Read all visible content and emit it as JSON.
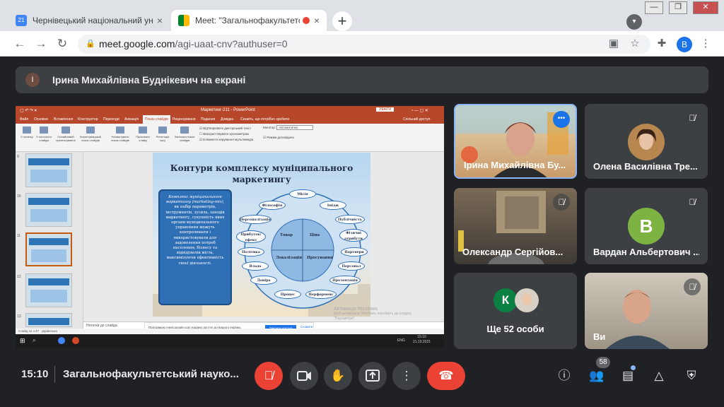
{
  "browser": {
    "tabs": [
      {
        "title": "Чернівецький національний уні",
        "icon": "calendar-21-icon",
        "close": "×"
      },
      {
        "title": "Meet: \"Загальнофакультетсь",
        "icon": "meet-icon",
        "close": "×"
      }
    ],
    "new_tab": "+",
    "url_host": "meet.google.com",
    "url_path": "/agi-uaat-cnv?authuser=0",
    "profile_initial": "B",
    "window_controls": [
      "—",
      "❐",
      "✕"
    ]
  },
  "meet": {
    "presenter_initial": "І",
    "presenting_banner": "Ірина Михайлівна Буднікевич на екрані",
    "participants": [
      {
        "name": "Ірина Михайлівна Бу...",
        "muted": false,
        "more": "•••"
      },
      {
        "name": "Олена Василівна Тре...",
        "muted": true
      },
      {
        "name": "Олександр Сергійов...",
        "muted": true
      },
      {
        "name": "Вардан Альбертович ...",
        "muted": true,
        "initial": "B"
      },
      {
        "name": "Ще 52 особи",
        "initial": "К"
      },
      {
        "name": "Ви",
        "muted": true
      }
    ],
    "clock": "15:10",
    "meeting_title": "Загальнофакультетський науко...",
    "participant_count": "58",
    "accent_colors": {
      "hangup": "#ea4335",
      "mic_off": "#ea4335",
      "avatar_v": "#7cb342",
      "avatar_k": "#0b8043"
    }
  },
  "powerpoint": {
    "window_title": "Маркетинг-211 - PowerPoint",
    "signin": "Увійти",
    "menu": [
      "Файл",
      "Основне",
      "Вставлення",
      "Конструктор",
      "Переходи",
      "Анімація",
      "Показ слайдів",
      "Рецензування",
      "Подання",
      "Довідка",
      "Скажіть, що потрібно зробити"
    ],
    "share_label": "Спільний доступ",
    "ribbon": [
      "З початку",
      "З поточного слайда",
      "Онлайновий презентування",
      "Користувацький показ слайдів",
      "Налаштувати показ слайдів",
      "Приховати слайд",
      "Репетиція часу",
      "Записати показ слайдів"
    ],
    "ribbon_checks": [
      "Відтворювати дикторський текст",
      "Використовувати хронометраж",
      "Елементи керування мультимедіа"
    ],
    "monitor_label": "Монітор:",
    "monitor_value": "Автоматично",
    "presenter_view": "Режим доповідача",
    "thumb_numbers": [
      "9",
      "10",
      "11",
      "12",
      "13"
    ],
    "notes_placeholder": "Нотатки до слайда",
    "status_left": "Слайд 11 з 47",
    "status_lang": "українська",
    "share_notice": "Програмою meet.google.com надано доступ до вашого екрана.",
    "share_stop": "Закрити доступ",
    "share_hide": "Сховати",
    "activation_line1": "Активація Windows",
    "activation_line2": "Щоб активувати Windows, перейдіть до розділу",
    "activation_line3": "\"Параметри\".",
    "taskbar_time": "15:10",
    "taskbar_date": "21.10.2021",
    "taskbar_lang": "ENG"
  },
  "slide": {
    "title_line1": "Контури комплексу муніципального",
    "title_line2": "маркетингу",
    "definition_lead": "Комплекс муніципального маркетингу (marketing-mix)",
    "definition_body": ", як набір параметрів, інструментів, зусиль, заходів маркетингу, сукупність яких органи муніципального управління можуть контролювати і використовувати для задоволення потреб населення, бізнесу та відвідувачів міста, максимізуючи ефективність своєї діяльності.",
    "core": [
      "Товар",
      "Ціна",
      "Локалізація",
      "Просування"
    ],
    "ring": [
      "Місія",
      "Філософія",
      "Імідж",
      "Персоналізація",
      "Публічність",
      "Прибуток/ ефект",
      "Фізичні атрибути",
      "Політика",
      "Партнери",
      "Влада",
      "Персонал",
      "Довіра",
      "Презентація",
      "Процес",
      "Перформенс"
    ]
  }
}
